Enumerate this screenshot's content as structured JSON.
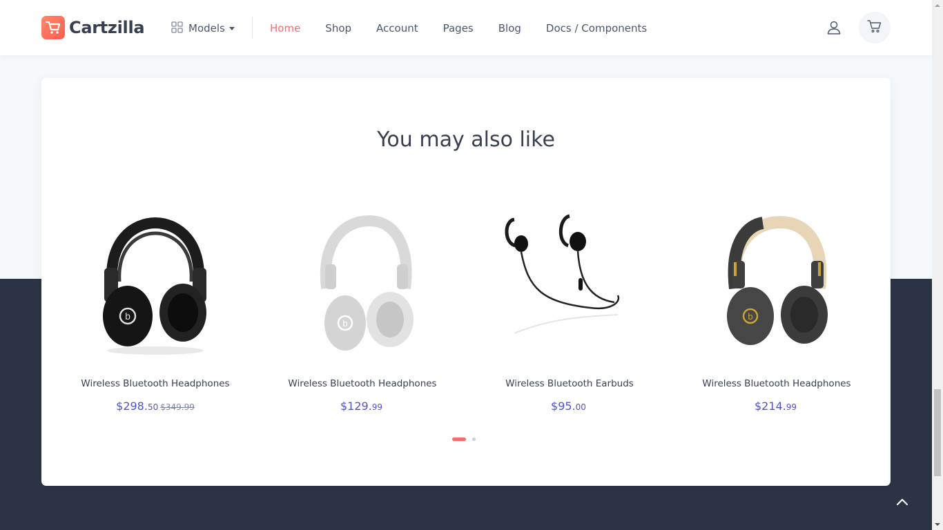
{
  "header": {
    "logo_text": "Cartzilla",
    "models_label": "Models",
    "nav": [
      {
        "label": "Home",
        "active": true
      },
      {
        "label": "Shop",
        "active": false
      },
      {
        "label": "Account",
        "active": false
      },
      {
        "label": "Pages",
        "active": false
      },
      {
        "label": "Blog",
        "active": false
      },
      {
        "label": "Docs / Components",
        "active": false
      }
    ],
    "icons": {
      "models": "grid-icon",
      "user": "user-icon",
      "cart": "cart-icon"
    }
  },
  "section": {
    "title": "You may also like"
  },
  "products": [
    {
      "name": "Wireless Bluetooth Headphones",
      "price_main": "$298.",
      "price_cents": "50",
      "price_old": "$349.99",
      "image": "black-headphones"
    },
    {
      "name": "Wireless Bluetooth Headphones",
      "price_main": "$129.",
      "price_cents": "99",
      "price_old": "",
      "image": "silver-headphones"
    },
    {
      "name": "Wireless Bluetooth Earbuds",
      "price_main": "$95.",
      "price_cents": "00",
      "price_old": "",
      "image": "black-earbuds"
    },
    {
      "name": "Wireless Bluetooth Headphones",
      "price_main": "$214.",
      "price_cents": "99",
      "price_old": "",
      "image": "gray-gold-headphones"
    }
  ],
  "carousel": {
    "pages": 2,
    "active_page": 1
  },
  "colors": {
    "accent": "#fe696a",
    "price": "#4e54c8",
    "dark_band": "#2b3445",
    "text": "#373f50"
  }
}
